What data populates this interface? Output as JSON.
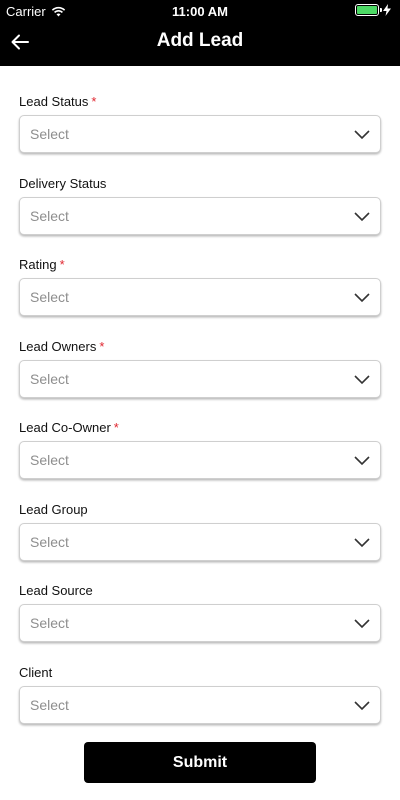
{
  "status_bar": {
    "carrier": "Carrier",
    "time": "11:00 AM",
    "battery_color": "#4cd964"
  },
  "header": {
    "title": "Add Lead",
    "back_icon": "arrow-left-icon",
    "background": "#000000"
  },
  "form": {
    "fields": [
      {
        "label": "Lead Status",
        "required": "*",
        "placeholder": "Select"
      },
      {
        "label": "Delivery Status",
        "required": "",
        "placeholder": "Select"
      },
      {
        "label": "Rating",
        "required": "*",
        "placeholder": "Select"
      },
      {
        "label": "Lead Owners",
        "required": "*",
        "placeholder": "Select"
      },
      {
        "label": "Lead Co-Owner",
        "required": "*",
        "placeholder": "Select"
      },
      {
        "label": "Lead Group",
        "required": "",
        "placeholder": "Select"
      },
      {
        "label": "Lead Source",
        "required": "",
        "placeholder": "Select"
      },
      {
        "label": "Client",
        "required": "",
        "placeholder": "Select"
      }
    ],
    "required_color": "#e0262f",
    "dropdown_icon": "chevron-down-icon"
  },
  "submit": {
    "label": "Submit"
  }
}
